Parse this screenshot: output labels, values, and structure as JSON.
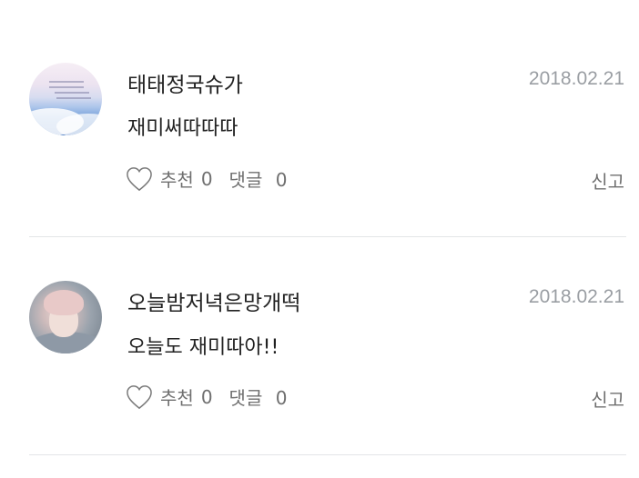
{
  "comments": [
    {
      "username": "태태정국슈가",
      "date": "2018.02.21",
      "text": "재미써따따따",
      "like_label": "추천",
      "like_count": "0",
      "reply_label": "댓글",
      "reply_count": "0",
      "report_label": "신고",
      "avatar": "sky-clouds-avatar"
    },
    {
      "username": "오늘밤저녁은망개떡",
      "date": "2018.02.21",
      "text": "오늘도 재미따아!!",
      "like_label": "추천",
      "like_count": "0",
      "reply_label": "댓글",
      "reply_count": "0",
      "report_label": "신고",
      "avatar": "person-avatar"
    }
  ],
  "colors": {
    "text": "#222222",
    "muted": "#6f6f6f",
    "date": "#9a9ea3",
    "divider": "#e3e5e7"
  }
}
